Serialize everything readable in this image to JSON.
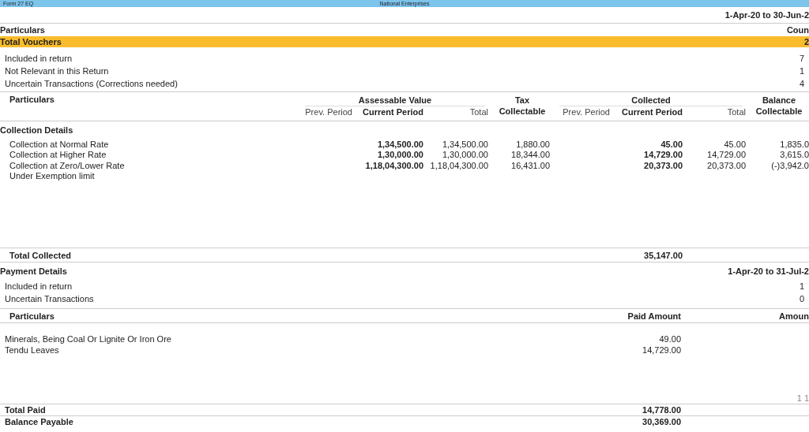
{
  "title_bar": {
    "left": "Form 27 EQ",
    "center": "National Enterprises"
  },
  "period": "1-Apr-20 to 30-Jun-2",
  "summary": {
    "columns": [
      "Particulars",
      "Coun"
    ],
    "total": {
      "label": "Total Vouchers",
      "count": "2",
      "selected": true
    },
    "rows": [
      {
        "label": "Included in return",
        "count": "7"
      },
      {
        "label": "Not Relevant in this Return",
        "count": "1"
      },
      {
        "label": "Uncertain Transactions (Corrections needed)",
        "count": "4"
      }
    ]
  },
  "collection": {
    "particulars_header": "Particulars",
    "groups": [
      {
        "label": "Assessable Value",
        "columns": [
          {
            "label": "Prev. Period",
            "emphasis": false
          },
          {
            "label": "Current Period",
            "emphasis": true
          },
          {
            "label": "Total",
            "emphasis": false
          }
        ]
      },
      {
        "label": "Tax",
        "columns": [
          {
            "label": "Collectable",
            "emphasis": true
          }
        ]
      },
      {
        "label": "Collected",
        "columns": [
          {
            "label": "Prev. Period",
            "emphasis": false
          },
          {
            "label": "Current Period",
            "emphasis": true
          },
          {
            "label": "Total",
            "emphasis": false
          }
        ]
      },
      {
        "label": "Balance",
        "columns": [
          {
            "label": "Collectable",
            "emphasis": true
          }
        ]
      }
    ],
    "section": "Collection Details",
    "rows": [
      {
        "particulars": "Collection at Normal Rate",
        "assessable_current": "1,34,500.00",
        "assessable_total": "1,34,500.00",
        "tax_collectable": "1,880.00",
        "collected_current": "45.00",
        "collected_total": "45.00",
        "balance_collectable": "1,835.0"
      },
      {
        "particulars": "Collection at Higher Rate",
        "assessable_current": "1,30,000.00",
        "assessable_total": "1,30,000.00",
        "tax_collectable": "18,344.00",
        "collected_current": "14,729.00",
        "collected_total": "14,729.00",
        "balance_collectable": "3,615.0"
      },
      {
        "particulars": "Collection at Zero/Lower Rate",
        "assessable_current": "1,18,04,300.00",
        "assessable_total": "1,18,04,300.00",
        "tax_collectable": "16,431.00",
        "collected_current": "20,373.00",
        "collected_total": "20,373.00",
        "balance_collectable": "(-)3,942.0"
      },
      {
        "particulars": "Under Exemption limit"
      }
    ],
    "total": {
      "label": "Total Collected",
      "collected_current": "35,147.00"
    }
  },
  "payment": {
    "section": "Payment Details",
    "period": "1-Apr-20 to 31-Jul-2",
    "rows": [
      {
        "label": "Included in return",
        "count": "1"
      },
      {
        "label": "Uncertain Transactions",
        "count": "0"
      }
    ],
    "columns": [
      "Particulars",
      "Paid Amount",
      "Amoun"
    ],
    "items": [
      {
        "particulars": "Minerals, Being Coal Or Lignite Or Iron Ore",
        "paid": "49.00"
      },
      {
        "particulars": "Tendu Leaves",
        "paid": "14,729.00"
      }
    ],
    "page_marker": "1 1",
    "total": {
      "label": "Total Paid",
      "paid": "14,778.00"
    },
    "balance": {
      "label": "Balance Payable",
      "paid": "30,369.00"
    }
  }
}
